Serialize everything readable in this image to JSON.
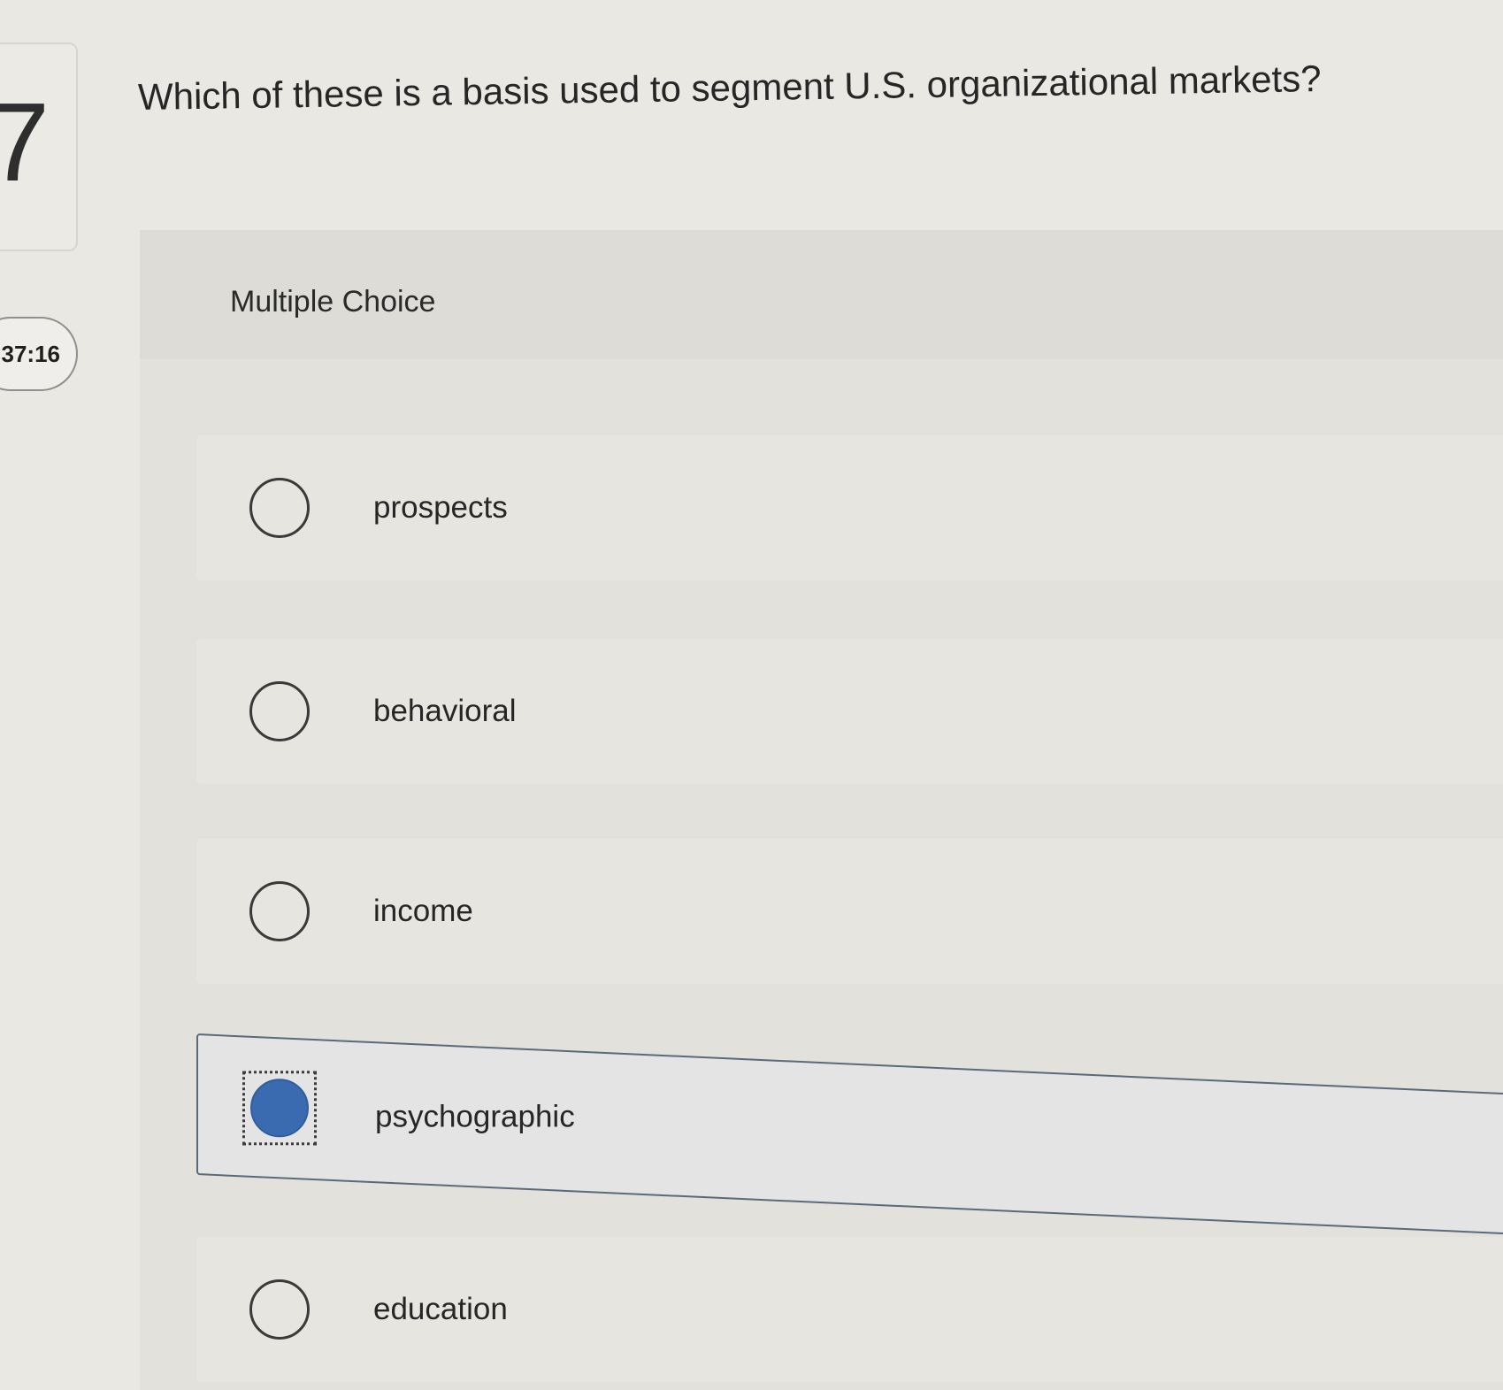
{
  "question_number": "7",
  "timer": ":37:16",
  "question": "Which of these is a basis used to segment U.S. organizational markets?",
  "section_label": "Multiple Choice",
  "choices": [
    {
      "label": "prospects",
      "selected": false
    },
    {
      "label": "behavioral",
      "selected": false
    },
    {
      "label": "income",
      "selected": false
    },
    {
      "label": "psychographic",
      "selected": true
    },
    {
      "label": "education",
      "selected": false
    }
  ],
  "colors": {
    "selected_radio": "#3a6bb0",
    "background": "#e9e8e3"
  }
}
